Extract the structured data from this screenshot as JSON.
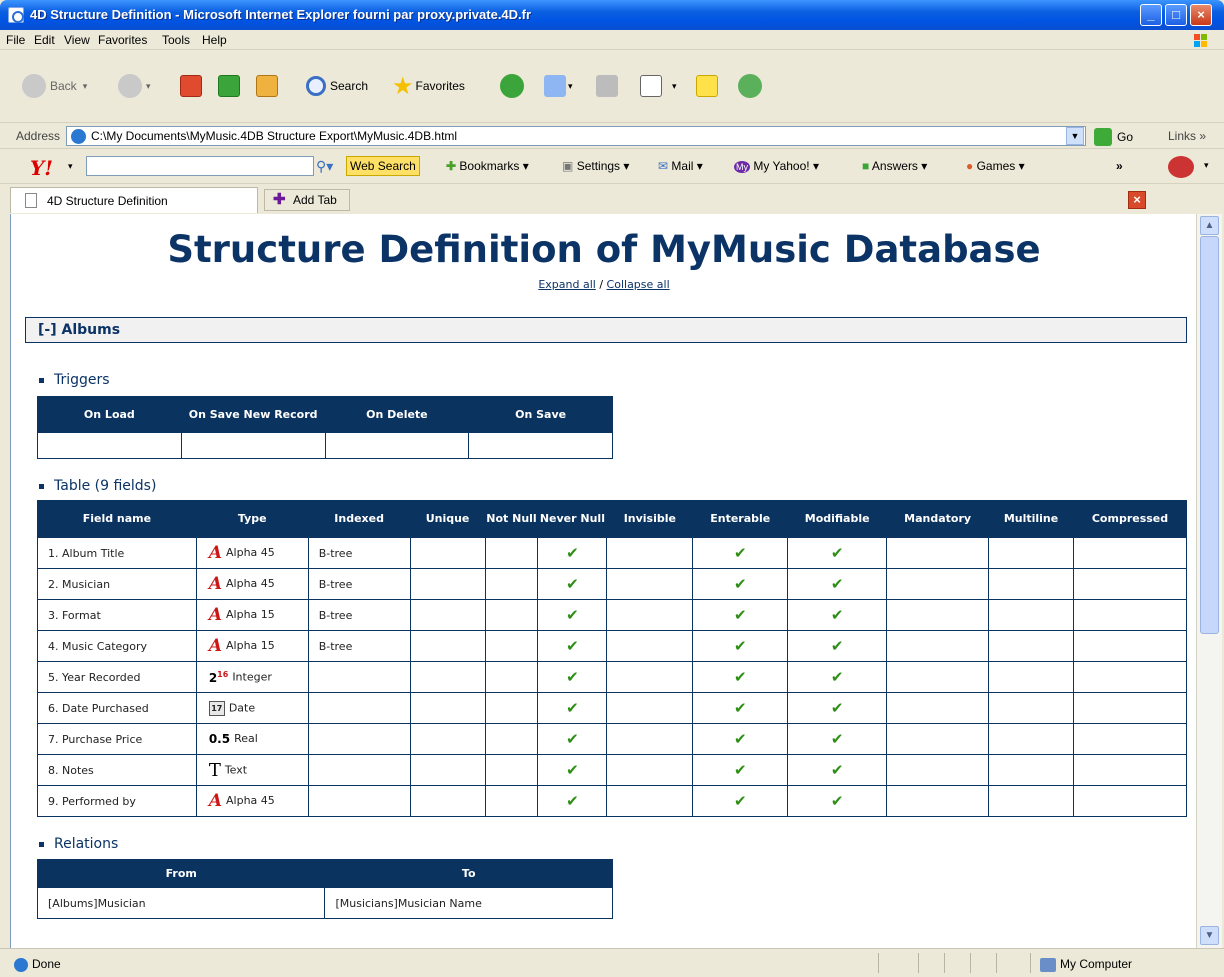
{
  "window": {
    "title": "4D Structure Definition - Microsoft Internet Explorer fourni par proxy.private.4D.fr"
  },
  "menu": [
    "File",
    "Edit",
    "View",
    "Favorites",
    "Tools",
    "Help"
  ],
  "toolbar": {
    "back": "Back",
    "search": "Search",
    "favorites": "Favorites"
  },
  "address": {
    "label": "Address",
    "url": "C:\\My Documents\\MyMusic.4DB Structure Export\\MyMusic.4DB.html",
    "go": "Go",
    "links": "Links"
  },
  "yahoo": {
    "web_search": "Web Search",
    "bookmarks": "Bookmarks",
    "settings": "Settings",
    "mail": "Mail",
    "my_yahoo": "My Yahoo!",
    "answers": "Answers",
    "games": "Games"
  },
  "tabs": {
    "active": "4D Structure Definition",
    "add": "Add Tab"
  },
  "status": {
    "done": "Done",
    "zone": "My Computer"
  },
  "page": {
    "title": "Structure Definition of MyMusic Database",
    "expand": "Expand all",
    "separator": "/",
    "collapse": "Collapse all",
    "section": "[-] Albums",
    "triggers_heading": "Triggers",
    "triggers_headers": [
      "On Load",
      "On Save New Record",
      "On Delete",
      "On Save"
    ],
    "table_heading": "Table (9 fields)",
    "field_headers": [
      "Field name",
      "Type",
      "Indexed",
      "Unique",
      "Not Null",
      "Never Null",
      "Invisible",
      "Enterable",
      "Modifiable",
      "Mandatory",
      "Multiline",
      "Compressed"
    ],
    "fields": [
      {
        "name": "1. Album Title",
        "type": "Alpha 45",
        "icon": "alpha-icon",
        "indexed": "B-tree",
        "never_null": "✔",
        "enterable": "✔",
        "modifiable": "✔"
      },
      {
        "name": "2. Musician",
        "type": "Alpha 45",
        "icon": "alpha-icon",
        "indexed": "B-tree",
        "never_null": "✔",
        "enterable": "✔",
        "modifiable": "✔"
      },
      {
        "name": "3. Format",
        "type": "Alpha 15",
        "icon": "alpha-icon",
        "indexed": "B-tree",
        "never_null": "✔",
        "enterable": "✔",
        "modifiable": "✔"
      },
      {
        "name": "4. Music Category",
        "type": "Alpha 15",
        "icon": "alpha-icon",
        "indexed": "B-tree",
        "never_null": "✔",
        "enterable": "✔",
        "modifiable": "✔"
      },
      {
        "name": "5. Year Recorded",
        "type": "Integer",
        "icon": "integer-icon",
        "indexed": "",
        "never_null": "✔",
        "enterable": "✔",
        "modifiable": "✔"
      },
      {
        "name": "6. Date Purchased",
        "type": "Date",
        "icon": "date-icon",
        "indexed": "",
        "never_null": "✔",
        "enterable": "✔",
        "modifiable": "✔"
      },
      {
        "name": "7. Purchase Price",
        "type": "Real",
        "icon": "real-icon",
        "indexed": "",
        "never_null": "✔",
        "enterable": "✔",
        "modifiable": "✔"
      },
      {
        "name": "8. Notes",
        "type": "Text",
        "icon": "text-icon",
        "indexed": "",
        "never_null": "✔",
        "enterable": "✔",
        "modifiable": "✔"
      },
      {
        "name": "9. Performed by",
        "type": "Alpha 45",
        "icon": "alpha-icon",
        "indexed": "",
        "never_null": "✔",
        "enterable": "✔",
        "modifiable": "✔"
      }
    ],
    "relations_heading": "Relations",
    "relations_headers": [
      "From",
      "To"
    ],
    "relations": [
      {
        "from": "[Albums]Musician",
        "to": "[Musicians]Musician Name"
      }
    ]
  }
}
